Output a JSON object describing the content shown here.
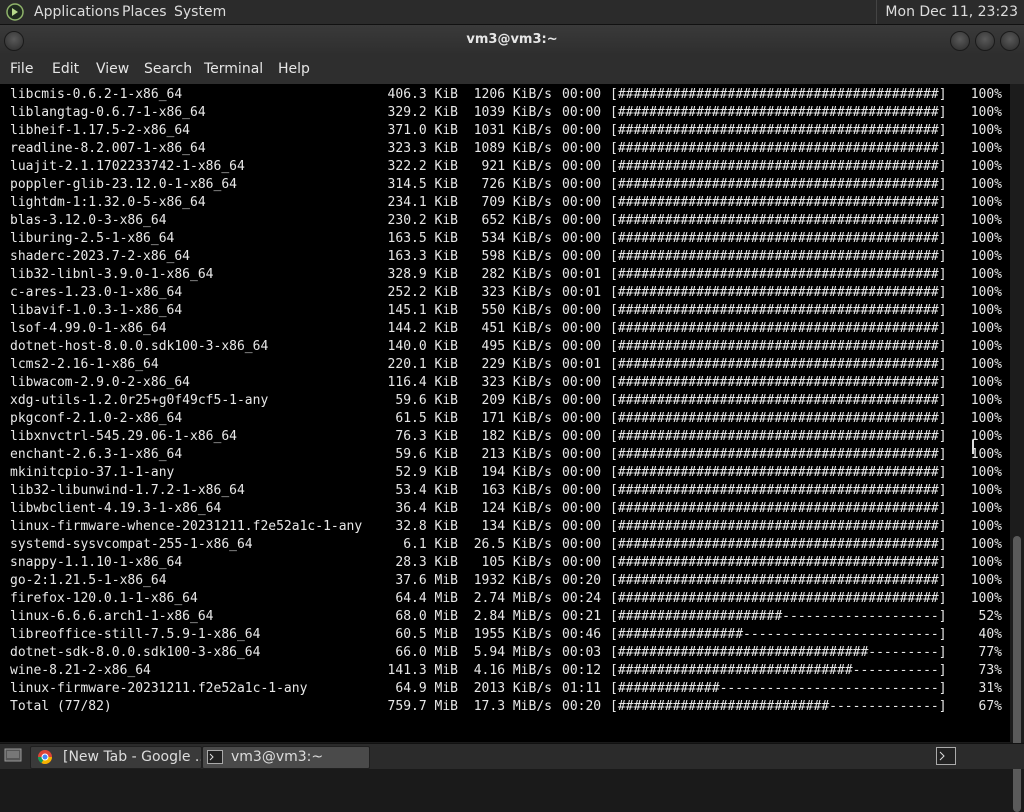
{
  "top_panel": {
    "menu": [
      "Applications",
      "Places",
      "System"
    ],
    "clock": "Mon Dec 11, 23:23"
  },
  "window": {
    "title": "vm3@vm3:~"
  },
  "menubar": [
    "File",
    "Edit",
    "View",
    "Search",
    "Terminal",
    "Help"
  ],
  "terminal": {
    "rows": [
      {
        "name": "libcmis-0.6.2-1-x86_64",
        "size": "406.3 KiB",
        "rate": "1206 KiB/s",
        "time": "00:00",
        "progress": 1.0,
        "pct": "100%"
      },
      {
        "name": "liblangtag-0.6.7-1-x86_64",
        "size": "329.2 KiB",
        "rate": "1039 KiB/s",
        "time": "00:00",
        "progress": 1.0,
        "pct": "100%"
      },
      {
        "name": "libheif-1.17.5-2-x86_64",
        "size": "371.0 KiB",
        "rate": "1031 KiB/s",
        "time": "00:00",
        "progress": 1.0,
        "pct": "100%"
      },
      {
        "name": "readline-8.2.007-1-x86_64",
        "size": "323.3 KiB",
        "rate": "1089 KiB/s",
        "time": "00:00",
        "progress": 1.0,
        "pct": "100%"
      },
      {
        "name": "luajit-2.1.1702233742-1-x86_64",
        "size": "322.2 KiB",
        "rate": "921 KiB/s",
        "time": "00:00",
        "progress": 1.0,
        "pct": "100%"
      },
      {
        "name": "poppler-glib-23.12.0-1-x86_64",
        "size": "314.5 KiB",
        "rate": "726 KiB/s",
        "time": "00:00",
        "progress": 1.0,
        "pct": "100%"
      },
      {
        "name": "lightdm-1:1.32.0-5-x86_64",
        "size": "234.1 KiB",
        "rate": "709 KiB/s",
        "time": "00:00",
        "progress": 1.0,
        "pct": "100%"
      },
      {
        "name": "blas-3.12.0-3-x86_64",
        "size": "230.2 KiB",
        "rate": "652 KiB/s",
        "time": "00:00",
        "progress": 1.0,
        "pct": "100%"
      },
      {
        "name": "liburing-2.5-1-x86_64",
        "size": "163.5 KiB",
        "rate": "534 KiB/s",
        "time": "00:00",
        "progress": 1.0,
        "pct": "100%"
      },
      {
        "name": "shaderc-2023.7-2-x86_64",
        "size": "163.3 KiB",
        "rate": "598 KiB/s",
        "time": "00:00",
        "progress": 1.0,
        "pct": "100%"
      },
      {
        "name": "lib32-libnl-3.9.0-1-x86_64",
        "size": "328.9 KiB",
        "rate": "282 KiB/s",
        "time": "00:01",
        "progress": 1.0,
        "pct": "100%"
      },
      {
        "name": "c-ares-1.23.0-1-x86_64",
        "size": "252.2 KiB",
        "rate": "323 KiB/s",
        "time": "00:01",
        "progress": 1.0,
        "pct": "100%"
      },
      {
        "name": "libavif-1.0.3-1-x86_64",
        "size": "145.1 KiB",
        "rate": "550 KiB/s",
        "time": "00:00",
        "progress": 1.0,
        "pct": "100%"
      },
      {
        "name": "lsof-4.99.0-1-x86_64",
        "size": "144.2 KiB",
        "rate": "451 KiB/s",
        "time": "00:00",
        "progress": 1.0,
        "pct": "100%"
      },
      {
        "name": "dotnet-host-8.0.0.sdk100-3-x86_64",
        "size": "140.0 KiB",
        "rate": "495 KiB/s",
        "time": "00:00",
        "progress": 1.0,
        "pct": "100%"
      },
      {
        "name": "lcms2-2.16-1-x86_64",
        "size": "220.1 KiB",
        "rate": "229 KiB/s",
        "time": "00:01",
        "progress": 1.0,
        "pct": "100%"
      },
      {
        "name": "libwacom-2.9.0-2-x86_64",
        "size": "116.4 KiB",
        "rate": "323 KiB/s",
        "time": "00:00",
        "progress": 1.0,
        "pct": "100%"
      },
      {
        "name": "xdg-utils-1.2.0r25+g0f49cf5-1-any",
        "size": "59.6 KiB",
        "rate": "209 KiB/s",
        "time": "00:00",
        "progress": 1.0,
        "pct": "100%"
      },
      {
        "name": "pkgconf-2.1.0-2-x86_64",
        "size": "61.5 KiB",
        "rate": "171 KiB/s",
        "time": "00:00",
        "progress": 1.0,
        "pct": "100%"
      },
      {
        "name": "libxnvctrl-545.29.06-1-x86_64",
        "size": "76.3 KiB",
        "rate": "182 KiB/s",
        "time": "00:00",
        "progress": 1.0,
        "pct": "100%"
      },
      {
        "name": "enchant-2.6.3-1-x86_64",
        "size": "59.6 KiB",
        "rate": "213 KiB/s",
        "time": "00:00",
        "progress": 1.0,
        "pct": "100%"
      },
      {
        "name": "mkinitcpio-37.1-1-any",
        "size": "52.9 KiB",
        "rate": "194 KiB/s",
        "time": "00:00",
        "progress": 1.0,
        "pct": "100%"
      },
      {
        "name": "lib32-libunwind-1.7.2-1-x86_64",
        "size": "53.4 KiB",
        "rate": "163 KiB/s",
        "time": "00:00",
        "progress": 1.0,
        "pct": "100%"
      },
      {
        "name": "libwbclient-4.19.3-1-x86_64",
        "size": "36.4 KiB",
        "rate": "124 KiB/s",
        "time": "00:00",
        "progress": 1.0,
        "pct": "100%"
      },
      {
        "name": "linux-firmware-whence-20231211.f2e52a1c-1-any",
        "size": "32.8 KiB",
        "rate": "134 KiB/s",
        "time": "00:00",
        "progress": 1.0,
        "pct": "100%"
      },
      {
        "name": "systemd-sysvcompat-255-1-x86_64",
        "size": "6.1 KiB",
        "rate": "26.5 KiB/s",
        "time": "00:00",
        "progress": 1.0,
        "pct": "100%"
      },
      {
        "name": "snappy-1.1.10-1-x86_64",
        "size": "28.3 KiB",
        "rate": "105 KiB/s",
        "time": "00:00",
        "progress": 1.0,
        "pct": "100%"
      },
      {
        "name": "go-2:1.21.5-1-x86_64",
        "size": "37.6 MiB",
        "rate": "1932 KiB/s",
        "time": "00:20",
        "progress": 1.0,
        "pct": "100%"
      },
      {
        "name": "firefox-120.0.1-1-x86_64",
        "size": "64.4 MiB",
        "rate": "2.74 MiB/s",
        "time": "00:24",
        "progress": 1.0,
        "pct": "100%"
      },
      {
        "name": "linux-6.6.6.arch1-1-x86_64",
        "size": "68.0 MiB",
        "rate": "2.84 MiB/s",
        "time": "00:21",
        "progress": 0.52,
        "pct": "52%"
      },
      {
        "name": "libreoffice-still-7.5.9-1-x86_64",
        "size": "60.5 MiB",
        "rate": "1955 KiB/s",
        "time": "00:46",
        "progress": 0.4,
        "pct": "40%"
      },
      {
        "name": "dotnet-sdk-8.0.0.sdk100-3-x86_64",
        "size": "66.0 MiB",
        "rate": "5.94 MiB/s",
        "time": "00:03",
        "progress": 0.77,
        "pct": "77%"
      },
      {
        "name": "wine-8.21-2-x86_64",
        "size": "141.3 MiB",
        "rate": "4.16 MiB/s",
        "time": "00:12",
        "progress": 0.73,
        "pct": "73%"
      },
      {
        "name": "linux-firmware-20231211.f2e52a1c-1-any",
        "size": "64.9 MiB",
        "rate": "2013 KiB/s",
        "time": "01:11",
        "progress": 0.31,
        "pct": "31%"
      },
      {
        "name": "Total (77/82)",
        "size": "759.7 MiB",
        "rate": "17.3 MiB/s",
        "time": "00:20",
        "progress": 0.67,
        "pct": "67%"
      }
    ]
  },
  "taskbar": {
    "tasks": [
      {
        "label": "[New Tab - Google ...",
        "icon": "chrome-icon",
        "active": false
      },
      {
        "label": "vm3@vm3:~",
        "icon": "terminal-icon",
        "active": true
      }
    ]
  }
}
